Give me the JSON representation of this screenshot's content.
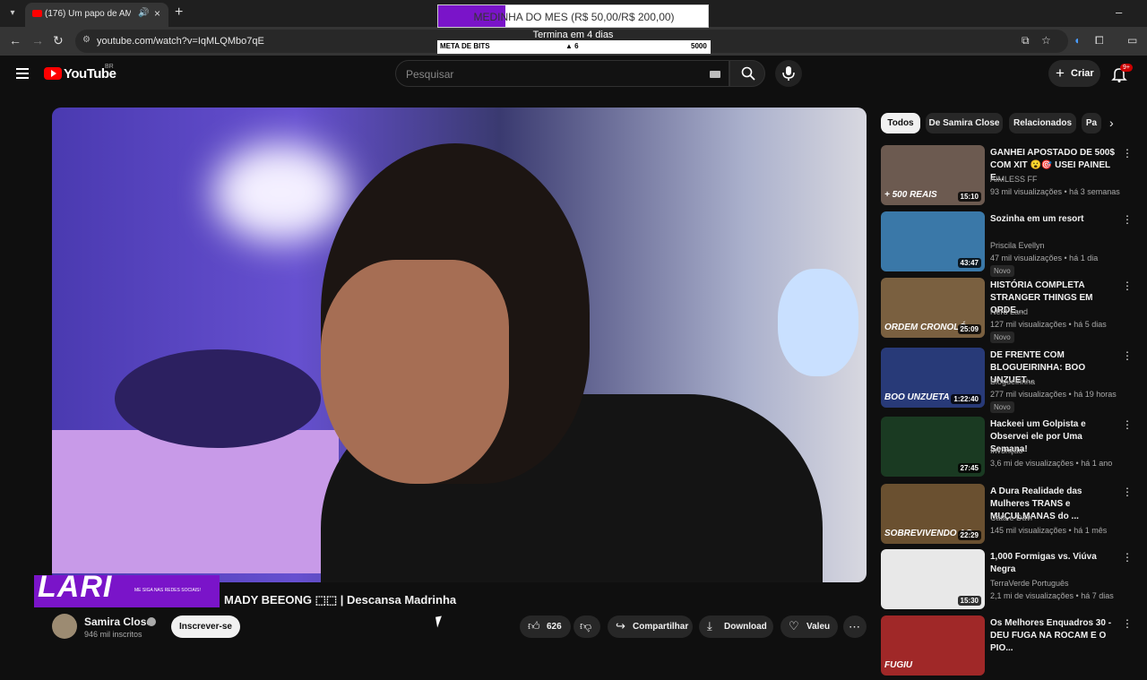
{
  "browser": {
    "tab_title": "(176) Um papo de AMIGAX",
    "url": "youtube.com/watch?v=IqMLQMbo7qE",
    "new_tab": "+",
    "close_tab": "×"
  },
  "overlay": {
    "goal_text": "MEDINHA DO MES (R$ 50,00/R$ 200,00)",
    "goal_progress": 0.25,
    "goal_sub": "Termina em 4 dias",
    "bits_label": "META DE BITS",
    "bits_value": "6",
    "bits_target": "5000"
  },
  "header": {
    "logo_text": "YouTube",
    "country": "BR",
    "search_placeholder": "Pesquisar",
    "create_label": "Criar",
    "notif_count": "9+"
  },
  "video": {
    "title": "MADY BEEONG ⬚⬚ | Descansa Madrinha",
    "branding": "LARI",
    "branding_sub": "ME SIGA NAS REDES SOCIAIS!",
    "channel": "Samira Close",
    "subscribers": "946 mil inscritos",
    "subscribe_label": "Inscrever-se",
    "likes": "626",
    "share_label": "Compartilhar",
    "download_label": "Download",
    "thanks_label": "Valeu",
    "more": "⋯"
  },
  "sidebar": {
    "chips": [
      "Todos",
      "De Samira Close",
      "Relacionados",
      "Pa"
    ],
    "items": [
      {
        "title": "GANHEI APOSTADO DE 500$ COM XIT 😮🎯 USEI PAINEL E...",
        "channel": "AIMLESS FF",
        "meta": "93 mil visualizações • há 3 semanas",
        "duration": "15:10",
        "new": "",
        "thumb_text": "+ 500 REAIS",
        "color": "#6c5a50"
      },
      {
        "title": "Sozinha em um resort",
        "channel": "Priscila Evellyn",
        "meta": "47 mil visualizações • há 1 dia",
        "duration": "43:47",
        "new": "Novo",
        "thumb_text": "",
        "color": "#3a78a8"
      },
      {
        "title": "HISTÓRIA COMPLETA STRANGER THINGS EM ORDE...",
        "channel": "Nerd Land",
        "meta": "127 mil visualizações • há 5 dias",
        "duration": "25:09",
        "new": "Novo",
        "thumb_text": "ORDEM CRONOLÓ",
        "color": "#7a6040"
      },
      {
        "title": "DE FRENTE COM BLOGUEIRINHA: BOO UNZUET...",
        "channel": "Blogueirinha",
        "meta": "277 mil visualizações • há 19 horas",
        "duration": "1:22:40",
        "new": "Novo",
        "thumb_text": "BOO UNZUETA",
        "color": "#283a78"
      },
      {
        "title": "Hackeei um Golpista e Observei ele por Uma Semana!",
        "channel": "Inv3nção",
        "meta": "3,6 mi de visualizações • há 1 ano",
        "duration": "27:45",
        "new": "",
        "thumb_text": "",
        "color": "#1a3a22"
      },
      {
        "title": "A Dura Realidade das Mulheres TRANS e MUÇULMANAS do ...",
        "channel": "Cata e Davi",
        "meta": "145 mil visualizações • há 1 mês",
        "duration": "22:29",
        "new": "",
        "thumb_text": "SOBREVIVENDO AO",
        "color": "#6a5030"
      },
      {
        "title": "1,000 Formigas vs. Viúva Negra",
        "channel": "TerraVerde Português",
        "meta": "2,1 mi de visualizações • há 7 dias",
        "duration": "15:30",
        "new": "",
        "thumb_text": "",
        "color": "#e8e8e8"
      },
      {
        "title": "Os Melhores Enquadros 30 - DEU FUGA NA ROCAM E O PIO...",
        "channel": "",
        "meta": "",
        "duration": "",
        "new": "",
        "thumb_text": "FUGIU",
        "color": "#a02828"
      }
    ]
  }
}
